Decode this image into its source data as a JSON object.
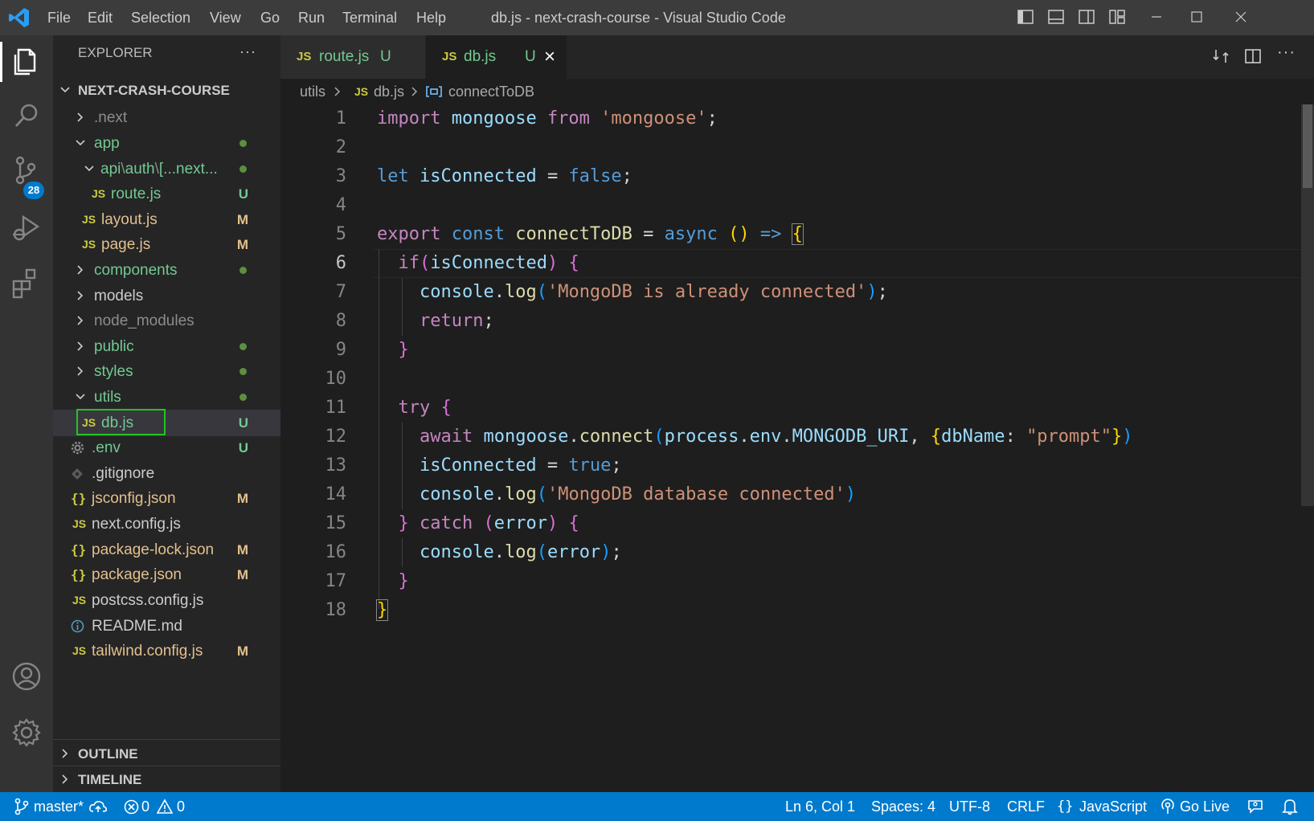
{
  "window": {
    "title": "db.js - next-crash-course - Visual Studio Code",
    "menu": [
      "File",
      "Edit",
      "Selection",
      "View",
      "Go",
      "Run",
      "Terminal",
      "Help"
    ]
  },
  "activity_bar": {
    "scm_badge": "28",
    "icons": [
      "explorer-icon",
      "search-icon",
      "source-control-icon",
      "run-debug-icon",
      "extensions-icon",
      "accounts-icon",
      "settings-gear-icon"
    ]
  },
  "explorer": {
    "header": "EXPLORER",
    "more": "···",
    "root": "NEXT-CRASH-COURSE",
    "items": [
      {
        "label": ".next",
        "kind": "folder",
        "open": false,
        "status": ""
      },
      {
        "label": "app",
        "kind": "folder",
        "open": true,
        "status": "dot"
      },
      {
        "label": "api",
        "sep1": "\\",
        "label2": "auth",
        "sep2": "\\",
        "label3": "[...next...",
        "kind": "folder",
        "open": true,
        "status": "dot"
      },
      {
        "label": "route.js",
        "icon": "JS",
        "status": "U"
      },
      {
        "label": "layout.js",
        "icon": "JS",
        "status": "M"
      },
      {
        "label": "page.js",
        "icon": "JS",
        "status": "M"
      },
      {
        "label": "components",
        "kind": "folder",
        "open": false,
        "status": "dot"
      },
      {
        "label": "models",
        "kind": "folder",
        "open": false,
        "status": ""
      },
      {
        "label": "node_modules",
        "kind": "folder",
        "open": false,
        "status": ""
      },
      {
        "label": "public",
        "kind": "folder",
        "open": false,
        "status": "dot"
      },
      {
        "label": "styles",
        "kind": "folder",
        "open": false,
        "status": "dot"
      },
      {
        "label": "utils",
        "kind": "folder",
        "open": true,
        "status": "dot"
      },
      {
        "label": "db.js",
        "icon": "JS",
        "status": "U"
      },
      {
        "label": ".env",
        "icon": "gear",
        "status": "U"
      },
      {
        "label": ".gitignore",
        "icon": "diamond",
        "status": ""
      },
      {
        "label": "jsconfig.json",
        "icon": "{}",
        "status": "M"
      },
      {
        "label": "next.config.js",
        "icon": "JS",
        "status": ""
      },
      {
        "label": "package-lock.json",
        "icon": "{}",
        "status": "M"
      },
      {
        "label": "package.json",
        "icon": "{}",
        "status": "M"
      },
      {
        "label": "postcss.config.js",
        "icon": "JS",
        "status": ""
      },
      {
        "label": "README.md",
        "icon": "info",
        "status": ""
      },
      {
        "label": "tailwind.config.js",
        "icon": "JS",
        "status": "M"
      }
    ],
    "outline": "OUTLINE",
    "timeline": "TIMELINE"
  },
  "tabs": [
    {
      "icon": "JS",
      "label": "route.js",
      "status": "U"
    },
    {
      "icon": "JS",
      "label": "db.js",
      "status": "U",
      "close": "×"
    }
  ],
  "breadcrumb": {
    "part1": "utils",
    "sep": ">",
    "part2": "db.js",
    "part3": "connectToDB",
    "icon": "JS"
  },
  "editor": {
    "line_numbers": [
      "1",
      "2",
      "3",
      "4",
      "5",
      "6",
      "7",
      "8",
      "9",
      "10",
      "11",
      "12",
      "13",
      "14",
      "15",
      "16",
      "17",
      "18"
    ],
    "current_line": "6",
    "tokens": {
      "l1": [
        "import",
        " mongoose ",
        "from",
        " ",
        "'mongoose'",
        ";"
      ],
      "l3": [
        "let",
        " isConnected ",
        "= ",
        "false",
        ";"
      ],
      "l5": [
        "export",
        " ",
        "const",
        " ",
        "connectToDB",
        " = ",
        "async",
        " ",
        "()",
        " ",
        "=>",
        " ",
        "{"
      ],
      "l6": [
        "  ",
        "if",
        "(",
        "isConnected",
        ")",
        " ",
        "{"
      ],
      "l7": [
        "    ",
        "console",
        ".",
        "log",
        "(",
        "'MongoDB is already connected'",
        ")",
        ";"
      ],
      "l8": [
        "    ",
        "return",
        ";"
      ],
      "l9": [
        "  ",
        "}"
      ],
      "l11": [
        "  ",
        "try",
        " ",
        "{"
      ],
      "l12": [
        "    ",
        "await",
        " ",
        "mongoose",
        ".",
        "connect",
        "(",
        "process",
        ".",
        "env",
        ".",
        "MONGODB_URI",
        ", ",
        "{",
        "dbName",
        ": ",
        "\"prompt\"",
        "}",
        ")"
      ],
      "l13": [
        "    ",
        "isConnected",
        " = ",
        "true",
        ";"
      ],
      "l14": [
        "    ",
        "console",
        ".",
        "log",
        "(",
        "'MongoDB database connected'",
        ")"
      ],
      "l15": [
        "  ",
        "}",
        " ",
        "catch",
        " ",
        "(",
        "error",
        ")",
        " ",
        "{"
      ],
      "l16": [
        "    ",
        "console",
        ".",
        "log",
        "(",
        "error",
        ")",
        ";"
      ],
      "l17": [
        "  ",
        "}"
      ],
      "l18": [
        "}"
      ]
    }
  },
  "statusbar": {
    "branch": "master*",
    "errors": "0",
    "warnings": "0",
    "position": "Ln 6, Col 1",
    "spaces": "Spaces: 4",
    "encoding": "UTF-8",
    "eol": "CRLF",
    "language": "JavaScript",
    "golive": "Go Live"
  },
  "colors": {
    "statusbar": "#007acc",
    "activitybar": "#333333",
    "sidebar": "#252526",
    "editor": "#1e1e1e",
    "untracked": "#73c991",
    "modified": "#e2c08d",
    "highlight_box": "#21c521"
  }
}
